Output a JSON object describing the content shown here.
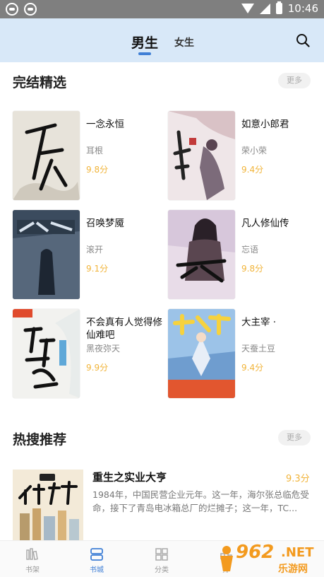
{
  "status_bar": {
    "time": "10:46"
  },
  "tabs": {
    "male": "男生",
    "female": "女生"
  },
  "sections": {
    "finished": {
      "title": "完结精选",
      "more": "更多"
    },
    "hot": {
      "title": "热搜推荐",
      "more": "更多"
    }
  },
  "books": [
    {
      "name": "一念永恒",
      "author": "耳根",
      "score": "9.8分",
      "cover_text": "一念永恒",
      "cover_color": "#e7e3da"
    },
    {
      "name": "如意小郎君",
      "author": "荣小荣",
      "score": "9.4分",
      "cover_text": "小郎君",
      "cover_color": "#efe6e8"
    },
    {
      "name": "召唤梦魇",
      "author": "滚开",
      "score": "9.1分",
      "cover_text": "召唤梦魇",
      "cover_color": "#46596e"
    },
    {
      "name": "凡人修仙传",
      "author": "忘语",
      "score": "9.8分",
      "cover_text": "修仙传",
      "cover_color": "#e8dce8"
    },
    {
      "name": "不会真有人觉得修仙难吧",
      "author": "黑夜弥天",
      "score": "9.9分",
      "cover_text": "不会真有人",
      "cover_color": "#f2f2ef"
    },
    {
      "name": "大主宰 ·",
      "author": "天蚕土豆",
      "score": "9.4分",
      "cover_text": "大主宰",
      "cover_color": "#8fb7e0"
    }
  ],
  "hot_book": {
    "name": "重生之实业大亨",
    "score": "9.3分",
    "cover_text": "实业大亨",
    "description": "1984年，中国民营企业元年。这一年，海尔张总临危受命，接下了青岛电冰箱总厂的烂摊子；这一年，TC..."
  },
  "bottom_nav": [
    {
      "label": "书架",
      "icon": "bookshelf-icon"
    },
    {
      "label": "书城",
      "icon": "bookstore-icon"
    },
    {
      "label": "分类",
      "icon": "category-icon"
    },
    {
      "label": "排",
      "icon": "ranking-icon"
    }
  ],
  "watermark": {
    "number": "962",
    "net": ".NET",
    "cn": "乐游网"
  },
  "colors": {
    "accent": "#3f7fd6",
    "score": "#f1b43a",
    "header_bg": "#d8e8f8"
  }
}
